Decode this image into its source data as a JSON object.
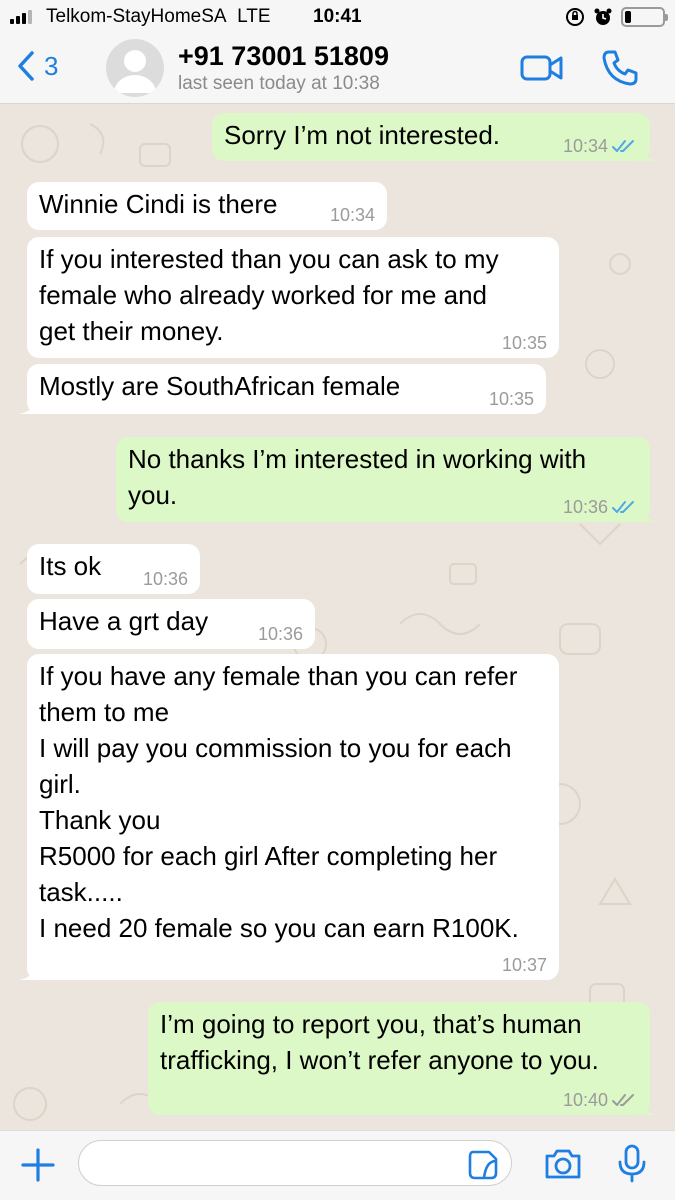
{
  "status_bar": {
    "carrier": "Telkom-StayHomeSA",
    "network": "LTE",
    "time": "10:41",
    "battery_level": 0.18
  },
  "header": {
    "back_count": "3",
    "contact_name": "+91 73001 51809",
    "last_seen": "last seen today at 10:38",
    "accent_color": "#1f7fe0"
  },
  "messages": [
    {
      "direction": "out",
      "text": "Sorry I’m not interested.",
      "time": "10:34",
      "ticks": "read"
    },
    {
      "direction": "in",
      "text": "Winnie Cindi is there",
      "time": "10:34"
    },
    {
      "direction": "in",
      "text": "If you interested than you can ask to my\nfemale who already worked for me and\nget their money.",
      "time": "10:35"
    },
    {
      "direction": "in",
      "text": "Mostly are SouthAfrican female",
      "time": "10:35"
    },
    {
      "direction": "out",
      "text": "No thanks I’m interested in working with\nyou.",
      "time": "10:36",
      "ticks": "read"
    },
    {
      "direction": "in",
      "text": "Its ok",
      "time": "10:36"
    },
    {
      "direction": "in",
      "text": "Have a grt day",
      "time": "10:36"
    },
    {
      "direction": "in",
      "text": "If you have any female than you can refer\nthem to me\nI will pay you commission to you for each\ngirl.\nThank you\nR5000 for each girl After completing her\ntask.....\nI need 20 female so you can earn R100K.",
      "time": "10:37"
    },
    {
      "direction": "out",
      "text": "I’m going to report you, that’s human\ntrafficking, I won’t refer anyone to you.",
      "time": "10:40",
      "ticks": "delivered"
    }
  ],
  "input_bar": {
    "placeholder": "",
    "icons": [
      "plus-icon",
      "sticker-icon",
      "camera-icon",
      "microphone-icon"
    ]
  },
  "colors": {
    "incoming_bubble": "#ffffff",
    "outgoing_bubble": "#dcf8c6",
    "chat_background": "#ece5dd",
    "read_tick": "#4fa9e6",
    "delivered_tick": "#9b9b9b"
  }
}
